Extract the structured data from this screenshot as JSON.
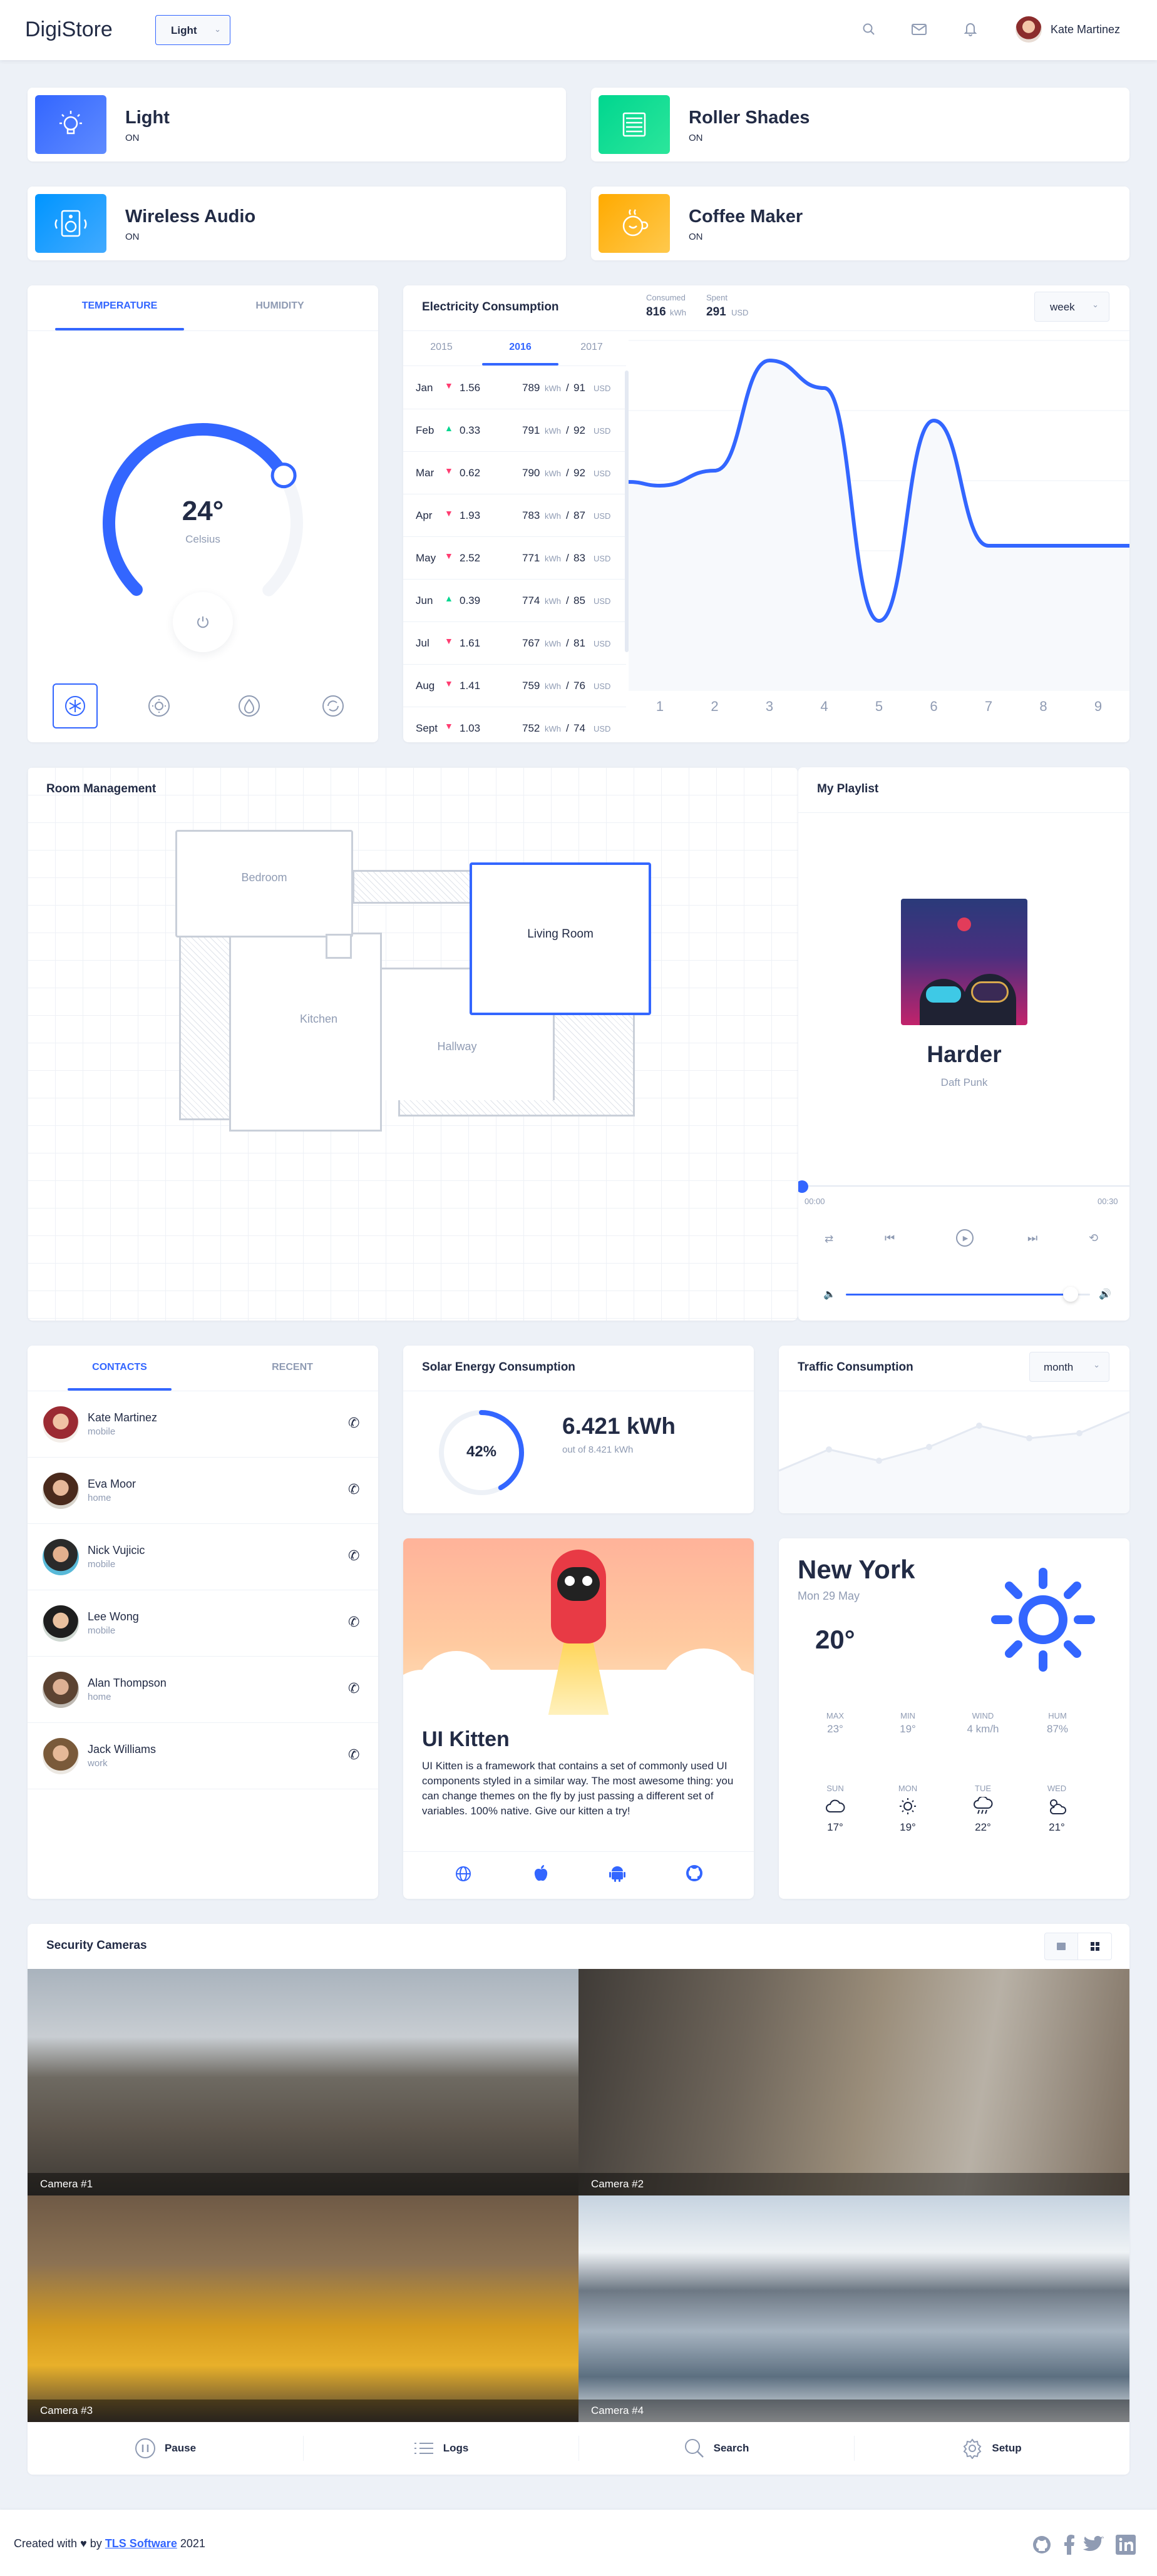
{
  "header": {
    "brand": "DigiStore",
    "theme_select": "Light",
    "user_name": "Kate Martinez"
  },
  "status_cards": [
    {
      "title": "Light",
      "status": "ON",
      "icon": "lightbulb-icon",
      "color": "#3366ff"
    },
    {
      "title": "Roller Shades",
      "status": "ON",
      "icon": "roller-shades-icon",
      "color": "#00d68f"
    },
    {
      "title": "Wireless Audio",
      "status": "ON",
      "icon": "speaker-icon",
      "color": "#0095ff"
    },
    {
      "title": "Coffee Maker",
      "status": "ON",
      "icon": "coffee-icon",
      "color": "#ffaa00"
    }
  ],
  "temperature": {
    "tabs": [
      "TEMPERATURE",
      "HUMIDITY"
    ],
    "active_tab": "TEMPERATURE",
    "value": "24°",
    "unit": "Celsius",
    "level": 0.72,
    "modes": [
      "snowflake-icon",
      "sun-icon",
      "drop-icon",
      "cycle-icon"
    ]
  },
  "electricity": {
    "title": "Electricity Consumption",
    "consumed_label": "Consumed",
    "consumed_value": "816",
    "consumed_unit": "kWh",
    "spent_label": "Spent",
    "spent_value": "291",
    "spent_unit": "USD",
    "period": "week",
    "years": [
      "2015",
      "2016",
      "2017"
    ],
    "active_year": "2016",
    "rows": [
      {
        "month": "Jan",
        "dir": "down",
        "delta": "1.56",
        "kwh": "789",
        "usd": "91"
      },
      {
        "month": "Feb",
        "dir": "up",
        "delta": "0.33",
        "kwh": "791",
        "usd": "92"
      },
      {
        "month": "Mar",
        "dir": "down",
        "delta": "0.62",
        "kwh": "790",
        "usd": "92"
      },
      {
        "month": "Apr",
        "dir": "down",
        "delta": "1.93",
        "kwh": "783",
        "usd": "87"
      },
      {
        "month": "May",
        "dir": "down",
        "delta": "2.52",
        "kwh": "771",
        "usd": "83"
      },
      {
        "month": "Jun",
        "dir": "up",
        "delta": "0.39",
        "kwh": "774",
        "usd": "85"
      },
      {
        "month": "Jul",
        "dir": "down",
        "delta": "1.61",
        "kwh": "767",
        "usd": "81"
      },
      {
        "month": "Aug",
        "dir": "down",
        "delta": "1.41",
        "kwh": "759",
        "usd": "76"
      },
      {
        "month": "Sept",
        "dir": "down",
        "delta": "1.03",
        "kwh": "752",
        "usd": "74"
      }
    ],
    "kwh_unit": "kWh",
    "usd_unit": "USD",
    "chart_x": [
      "1",
      "2",
      "3",
      "4",
      "5",
      "6",
      "7",
      "8",
      "9"
    ]
  },
  "chart_data": {
    "type": "line",
    "x": [
      1,
      2,
      3,
      4,
      5,
      6,
      7,
      8,
      9
    ],
    "values": [
      390,
      420,
      640,
      585,
      120,
      520,
      270,
      270,
      270
    ],
    "xlabel": "",
    "ylabel": "",
    "grid": true,
    "ylim": [
      0,
      700
    ]
  },
  "rooms": {
    "title": "Room Management",
    "labels": {
      "bedroom": "Bedroom",
      "living": "Living Room",
      "kitchen": "Kitchen",
      "hallway": "Hallway"
    }
  },
  "playlist": {
    "title": "My Playlist",
    "song": "Harder",
    "artist": "Daft Punk",
    "time_start": "00:00",
    "time_end": "00:30",
    "progress": 0.0,
    "volume": 0.92
  },
  "contacts": {
    "tabs": [
      "CONTACTS",
      "RECENT"
    ],
    "items": [
      {
        "name": "Kate Martinez",
        "type": "mobile"
      },
      {
        "name": "Eva Moor",
        "type": "home"
      },
      {
        "name": "Nick Vujicic",
        "type": "mobile"
      },
      {
        "name": "Lee Wong",
        "type": "mobile"
      },
      {
        "name": "Alan Thompson",
        "type": "home"
      },
      {
        "name": "Jack Williams",
        "type": "work"
      }
    ]
  },
  "solar": {
    "title": "Solar Energy Consumption",
    "percent": "42%",
    "fraction": 0.42,
    "value": "6.421 kWh",
    "sub": "out of 8.421 kWh"
  },
  "traffic": {
    "title": "Traffic Consumption",
    "period": "month"
  },
  "kitten": {
    "title": "UI Kitten",
    "text": "UI Kitten is a framework that contains a set of commonly used UI components styled in a similar way. The most awesome thing: you can change themes on the fly by just passing a different set of variables. 100% native. Give our kitten a try!",
    "links": [
      "globe-icon",
      "apple-icon",
      "android-icon",
      "github-icon"
    ]
  },
  "weather": {
    "city": "New York",
    "date": "Mon 29 May",
    "temp": "20°",
    "stats": [
      {
        "label": "MAX",
        "value": "23°"
      },
      {
        "label": "MIN",
        "value": "19°"
      },
      {
        "label": "WIND",
        "value": "4 km/h"
      },
      {
        "label": "HUM",
        "value": "87%"
      }
    ],
    "forecast": [
      {
        "day": "SUN",
        "icon": "cloud-icon",
        "temp": "17°"
      },
      {
        "day": "MON",
        "icon": "sun-icon",
        "temp": "19°"
      },
      {
        "day": "TUE",
        "icon": "rain-icon",
        "temp": "22°"
      },
      {
        "day": "WED",
        "icon": "partly-cloudy-icon",
        "temp": "21°"
      }
    ]
  },
  "cameras": {
    "title": "Security Cameras",
    "items": [
      "Camera #1",
      "Camera #2",
      "Camera #3",
      "Camera #4"
    ],
    "actions": [
      {
        "label": "Pause",
        "icon": "pause-icon"
      },
      {
        "label": "Logs",
        "icon": "list-icon"
      },
      {
        "label": "Search",
        "icon": "search-icon"
      },
      {
        "label": "Setup",
        "icon": "gear-icon"
      }
    ]
  },
  "footer": {
    "created_prefix": "Created with",
    "heart": "♥",
    "by": "by",
    "company": "TLS Software",
    "year": "2021"
  }
}
